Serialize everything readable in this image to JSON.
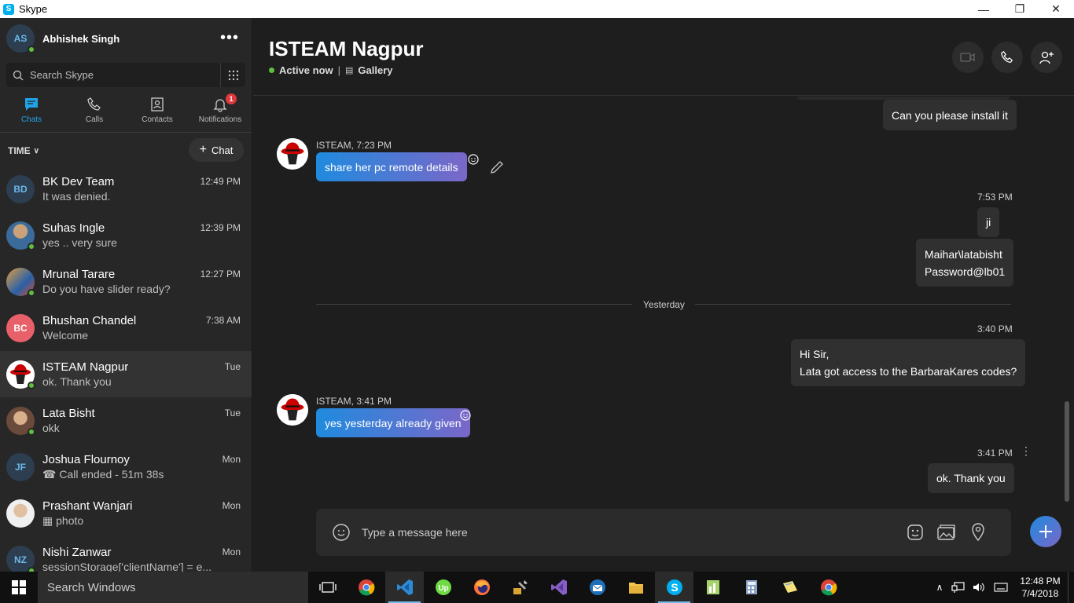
{
  "window": {
    "title": "Skype",
    "logo": "S"
  },
  "profile": {
    "initials": "AS",
    "name": "Abhishek Singh"
  },
  "search": {
    "placeholder": "Search Skype"
  },
  "nav": [
    {
      "label": "Chats"
    },
    {
      "label": "Calls"
    },
    {
      "label": "Contacts"
    },
    {
      "label": "Notifications",
      "badge": "1"
    }
  ],
  "list_header": {
    "sort": "TIME",
    "new_chat": "Chat"
  },
  "chats": [
    {
      "name": "BK Dev Team",
      "initials": "BD",
      "msg": "It was denied.",
      "time": "12:49 PM"
    },
    {
      "name": "Suhas Ingle",
      "msg": "yes .. very sure",
      "time": "12:39 PM"
    },
    {
      "name": "Mrunal Tarare",
      "msg": "Do you have slider ready?",
      "time": "12:27 PM"
    },
    {
      "name": "Bhushan Chandel",
      "initials": "BC",
      "msg": "Welcome",
      "time": "7:38 AM"
    },
    {
      "name": "ISTEAM Nagpur",
      "msg": "ok. Thank you",
      "time": "Tue"
    },
    {
      "name": "Lata Bisht",
      "msg": "okk",
      "time": "Tue"
    },
    {
      "name": "Joshua Flournoy",
      "initials": "JF",
      "msg": "Call ended - 51m 38s",
      "time": "Mon"
    },
    {
      "name": "Prashant Wanjari",
      "msg": "photo",
      "time": "Mon"
    },
    {
      "name": "Nishi Zanwar",
      "initials": "NZ",
      "msg": "sessionStorage['clientName'] = e...",
      "time": "Mon"
    }
  ],
  "conversation": {
    "title": "ISTEAM Nagpur",
    "status": "Active now",
    "separator": "|",
    "gallery": "Gallery",
    "messages": {
      "m1": "Can you please install it",
      "m2_sender": "ISTEAM, 7:23 PM",
      "m2": "share  her pc  remote details",
      "m3_time": "7:53 PM",
      "m3": "ji",
      "m4a": "Maihar\\latabisht",
      "m4b": "Password@lb01",
      "divider": "Yesterday",
      "m5_time": "3:40 PM",
      "m5a": "Hi Sir,",
      "m5b": "Lata got access to the BarbaraKares codes?",
      "m6_sender": "ISTEAM, 3:41 PM",
      "m6": "yes yesterday already given",
      "m7_time": "3:41 PM",
      "m7": "ok. Thank you"
    },
    "composer_placeholder": "Type a message here"
  },
  "taskbar": {
    "search": "Search Windows",
    "time": "12:48 PM",
    "date": "7/4/2018"
  }
}
